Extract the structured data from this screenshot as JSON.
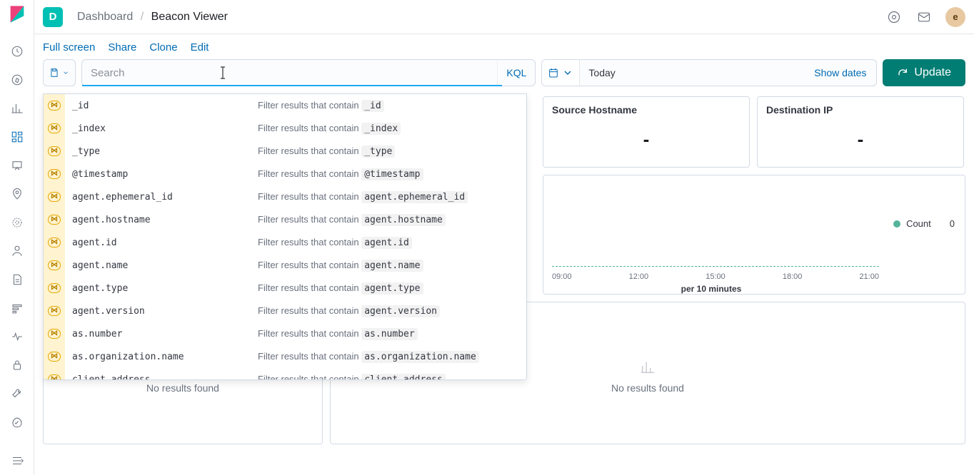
{
  "header": {
    "space_initial": "D",
    "breadcrumb_root": "Dashboard",
    "breadcrumb_current": "Beacon Viewer",
    "avatar_initial": "e"
  },
  "actions": {
    "full_screen": "Full screen",
    "share": "Share",
    "clone": "Clone",
    "edit": "Edit"
  },
  "search": {
    "placeholder": "Search",
    "kql": "KQL"
  },
  "date": {
    "label": "Today",
    "show_dates": "Show dates"
  },
  "update_button": "Update",
  "autocomplete": {
    "desc_prefix": "Filter results that contain",
    "items": [
      "_id",
      "_index",
      "_type",
      "@timestamp",
      "agent.ephemeral_id",
      "agent.hostname",
      "agent.id",
      "agent.name",
      "agent.type",
      "agent.version",
      "as.number",
      "as.organization.name",
      "client.address"
    ]
  },
  "panels": {
    "source_hostname": {
      "title": "Source Hostname",
      "value": "-"
    },
    "destination_ip": {
      "title": "Destination IP",
      "value": "-"
    },
    "chart": {
      "legend_label": "Count",
      "legend_value": "0",
      "ticks": [
        "09:00",
        "12:00",
        "15:00",
        "18:00",
        "21:00"
      ],
      "caption": "per 10 minutes"
    },
    "no_results": "No results found"
  },
  "chart_data": {
    "type": "bar",
    "title": "",
    "xlabel": "per 10 minutes",
    "ylabel": "",
    "categories": [
      "09:00",
      "12:00",
      "15:00",
      "18:00",
      "21:00"
    ],
    "series": [
      {
        "name": "Count",
        "values": [
          0,
          0,
          0,
          0,
          0
        ]
      }
    ],
    "ylim": [
      0,
      0
    ]
  }
}
